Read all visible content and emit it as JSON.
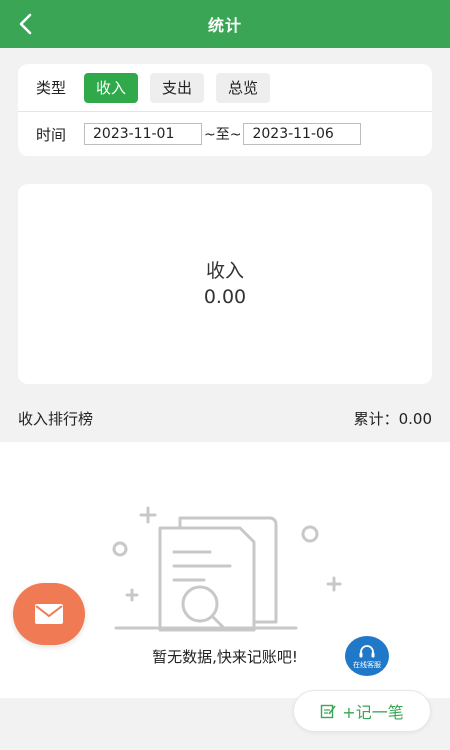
{
  "header": {
    "title": "统计"
  },
  "filter": {
    "type_label": "类型",
    "types": [
      "收入",
      "支出",
      "总览"
    ],
    "active_type": "收入",
    "time_label": "时间",
    "start_date": "2023-11-01",
    "separator": "~至~",
    "end_date": "2023-11-06"
  },
  "summary": {
    "label": "收入",
    "value": "0.00"
  },
  "ranking": {
    "title": "收入排行榜",
    "total": "累计：0.00"
  },
  "empty": {
    "text": "暂无数据,快来记账吧!"
  },
  "service": {
    "label": "在线客服"
  },
  "add_button": {
    "label": "+记一笔"
  },
  "colors": {
    "brand_green": "#3aa655",
    "fab_orange": "#f07a53",
    "service_blue": "#1f78c8"
  },
  "icons": [
    "back-arrow-icon",
    "mail-icon",
    "headset-icon",
    "note-edit-icon",
    "empty-document-search-icon"
  ]
}
